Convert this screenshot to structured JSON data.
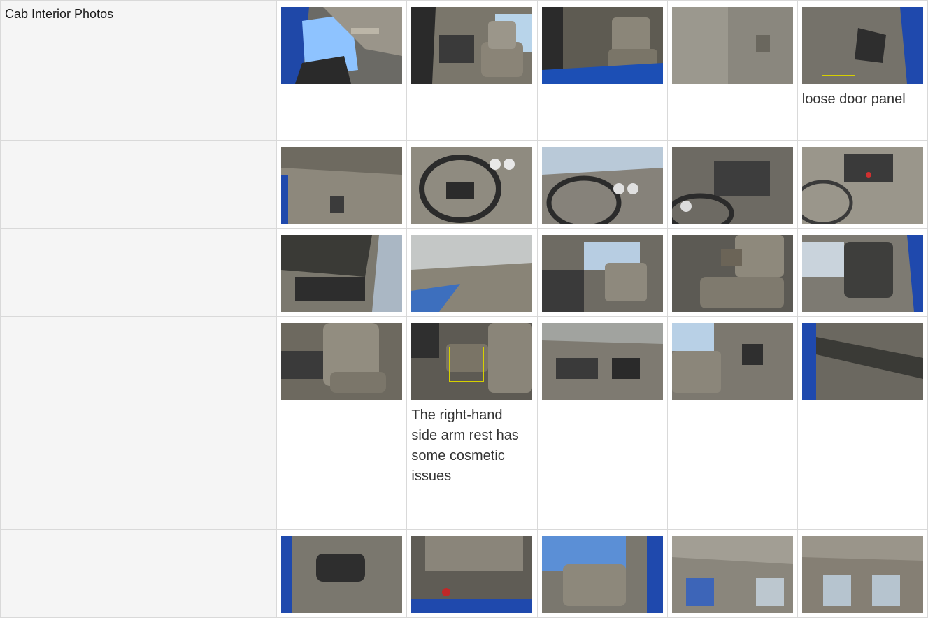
{
  "section": {
    "label": "Cab Interior Photos"
  },
  "rows": [
    {
      "photos": [
        {
          "name": "door-open-headliner",
          "caption": ""
        },
        {
          "name": "seat-view-cab",
          "caption": ""
        },
        {
          "name": "door-jamb-seat",
          "caption": ""
        },
        {
          "name": "glare-closeup",
          "caption": ""
        },
        {
          "name": "door-panel-handle",
          "caption": "loose door panel"
        }
      ]
    },
    {
      "photos": [
        {
          "name": "floor-pedals",
          "caption": ""
        },
        {
          "name": "steering-wheel",
          "caption": ""
        },
        {
          "name": "dashboard-windshield",
          "caption": ""
        },
        {
          "name": "instrument-cluster",
          "caption": ""
        },
        {
          "name": "center-console",
          "caption": ""
        }
      ]
    },
    {
      "photos": [
        {
          "name": "passenger-door",
          "caption": ""
        },
        {
          "name": "dash-top",
          "caption": ""
        },
        {
          "name": "driver-seat",
          "caption": ""
        },
        {
          "name": "seat-armrest-side",
          "caption": ""
        },
        {
          "name": "passenger-seat",
          "caption": ""
        }
      ]
    },
    {
      "photos": [
        {
          "name": "seat-armrest",
          "caption": ""
        },
        {
          "name": "armrest-damage",
          "caption": "The right-hand side arm rest has some cosmetic issues"
        },
        {
          "name": "door-handle-panel",
          "caption": ""
        },
        {
          "name": "door-seat-view",
          "caption": ""
        },
        {
          "name": "door-interior-panel",
          "caption": ""
        }
      ]
    },
    {
      "photos": [
        {
          "name": "door-handle-closeup",
          "caption": ""
        },
        {
          "name": "sleeper-floor",
          "caption": ""
        },
        {
          "name": "seat-sky",
          "caption": ""
        },
        {
          "name": "sleeper-ceiling",
          "caption": ""
        },
        {
          "name": "sleeper-rear",
          "caption": ""
        }
      ]
    }
  ],
  "colors": {
    "label_bg": "#f5f5f5",
    "grid": "#d9d9d9",
    "highlight": "#d6d000"
  }
}
